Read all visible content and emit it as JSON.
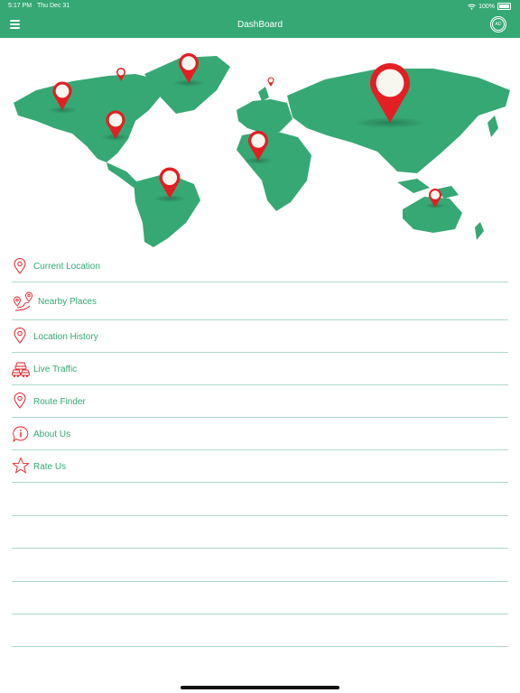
{
  "status": {
    "time": "5:17 PM",
    "date": "Thu Dec 31",
    "battery": "100%"
  },
  "header": {
    "title": "DashBoard",
    "ad_label": "AD"
  },
  "colors": {
    "primary": "#36a874",
    "accent": "#e31e24",
    "divider": "#aed9c5"
  },
  "menu": {
    "items": [
      {
        "label": "Current Location",
        "icon": "location-pin-icon"
      },
      {
        "label": "Nearby Places",
        "icon": "nearby-places-icon"
      },
      {
        "label": "Location History",
        "icon": "location-pin-icon"
      },
      {
        "label": "Live Traffic",
        "icon": "traffic-cars-icon"
      },
      {
        "label": "Route Finder",
        "icon": "location-pin-icon"
      },
      {
        "label": "About Us",
        "icon": "info-bubble-icon"
      },
      {
        "label": "Rate Us",
        "icon": "star-icon"
      }
    ]
  }
}
